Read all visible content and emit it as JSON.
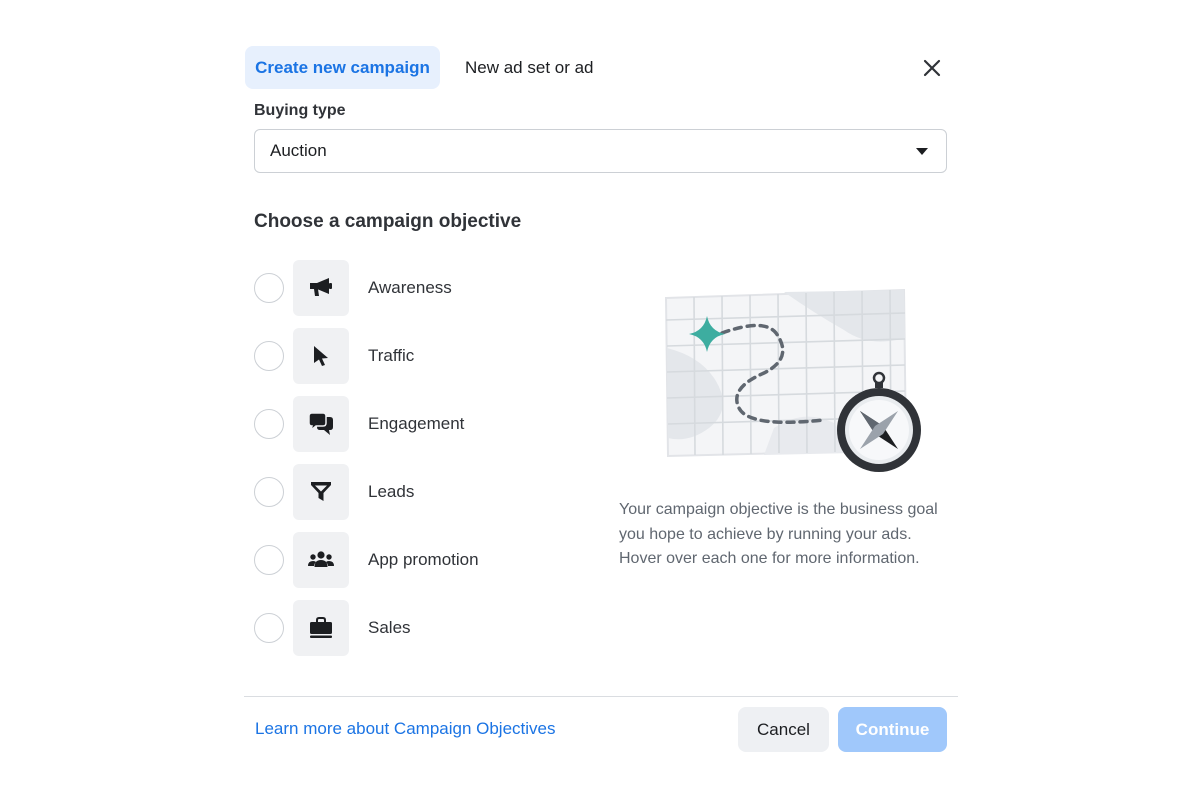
{
  "tabs": {
    "active_label": "Create new campaign",
    "inactive_label": "New ad set or ad"
  },
  "buying_type": {
    "label": "Buying type",
    "selected_value": "Auction"
  },
  "objective_section": {
    "title": "Choose a campaign objective",
    "options": [
      {
        "label": "Awareness",
        "icon": "megaphone-icon"
      },
      {
        "label": "Traffic",
        "icon": "cursor-icon"
      },
      {
        "label": "Engagement",
        "icon": "chat-bubbles-icon"
      },
      {
        "label": "Leads",
        "icon": "funnel-icon"
      },
      {
        "label": "App promotion",
        "icon": "people-group-icon"
      },
      {
        "label": "Sales",
        "icon": "briefcase-icon"
      }
    ],
    "description": "Your campaign objective is the business goal you hope to achieve by running your ads. Hover over each one for more information."
  },
  "footer": {
    "learn_more": "Learn more about Campaign Objectives",
    "cancel_label": "Cancel",
    "continue_label": "Continue"
  },
  "colors": {
    "accent": "#1b74e4",
    "active_tab_bg": "#e7f0fd",
    "continue_disabled_bg": "#a0c8fb",
    "illustration_teal": "#3dada0"
  }
}
